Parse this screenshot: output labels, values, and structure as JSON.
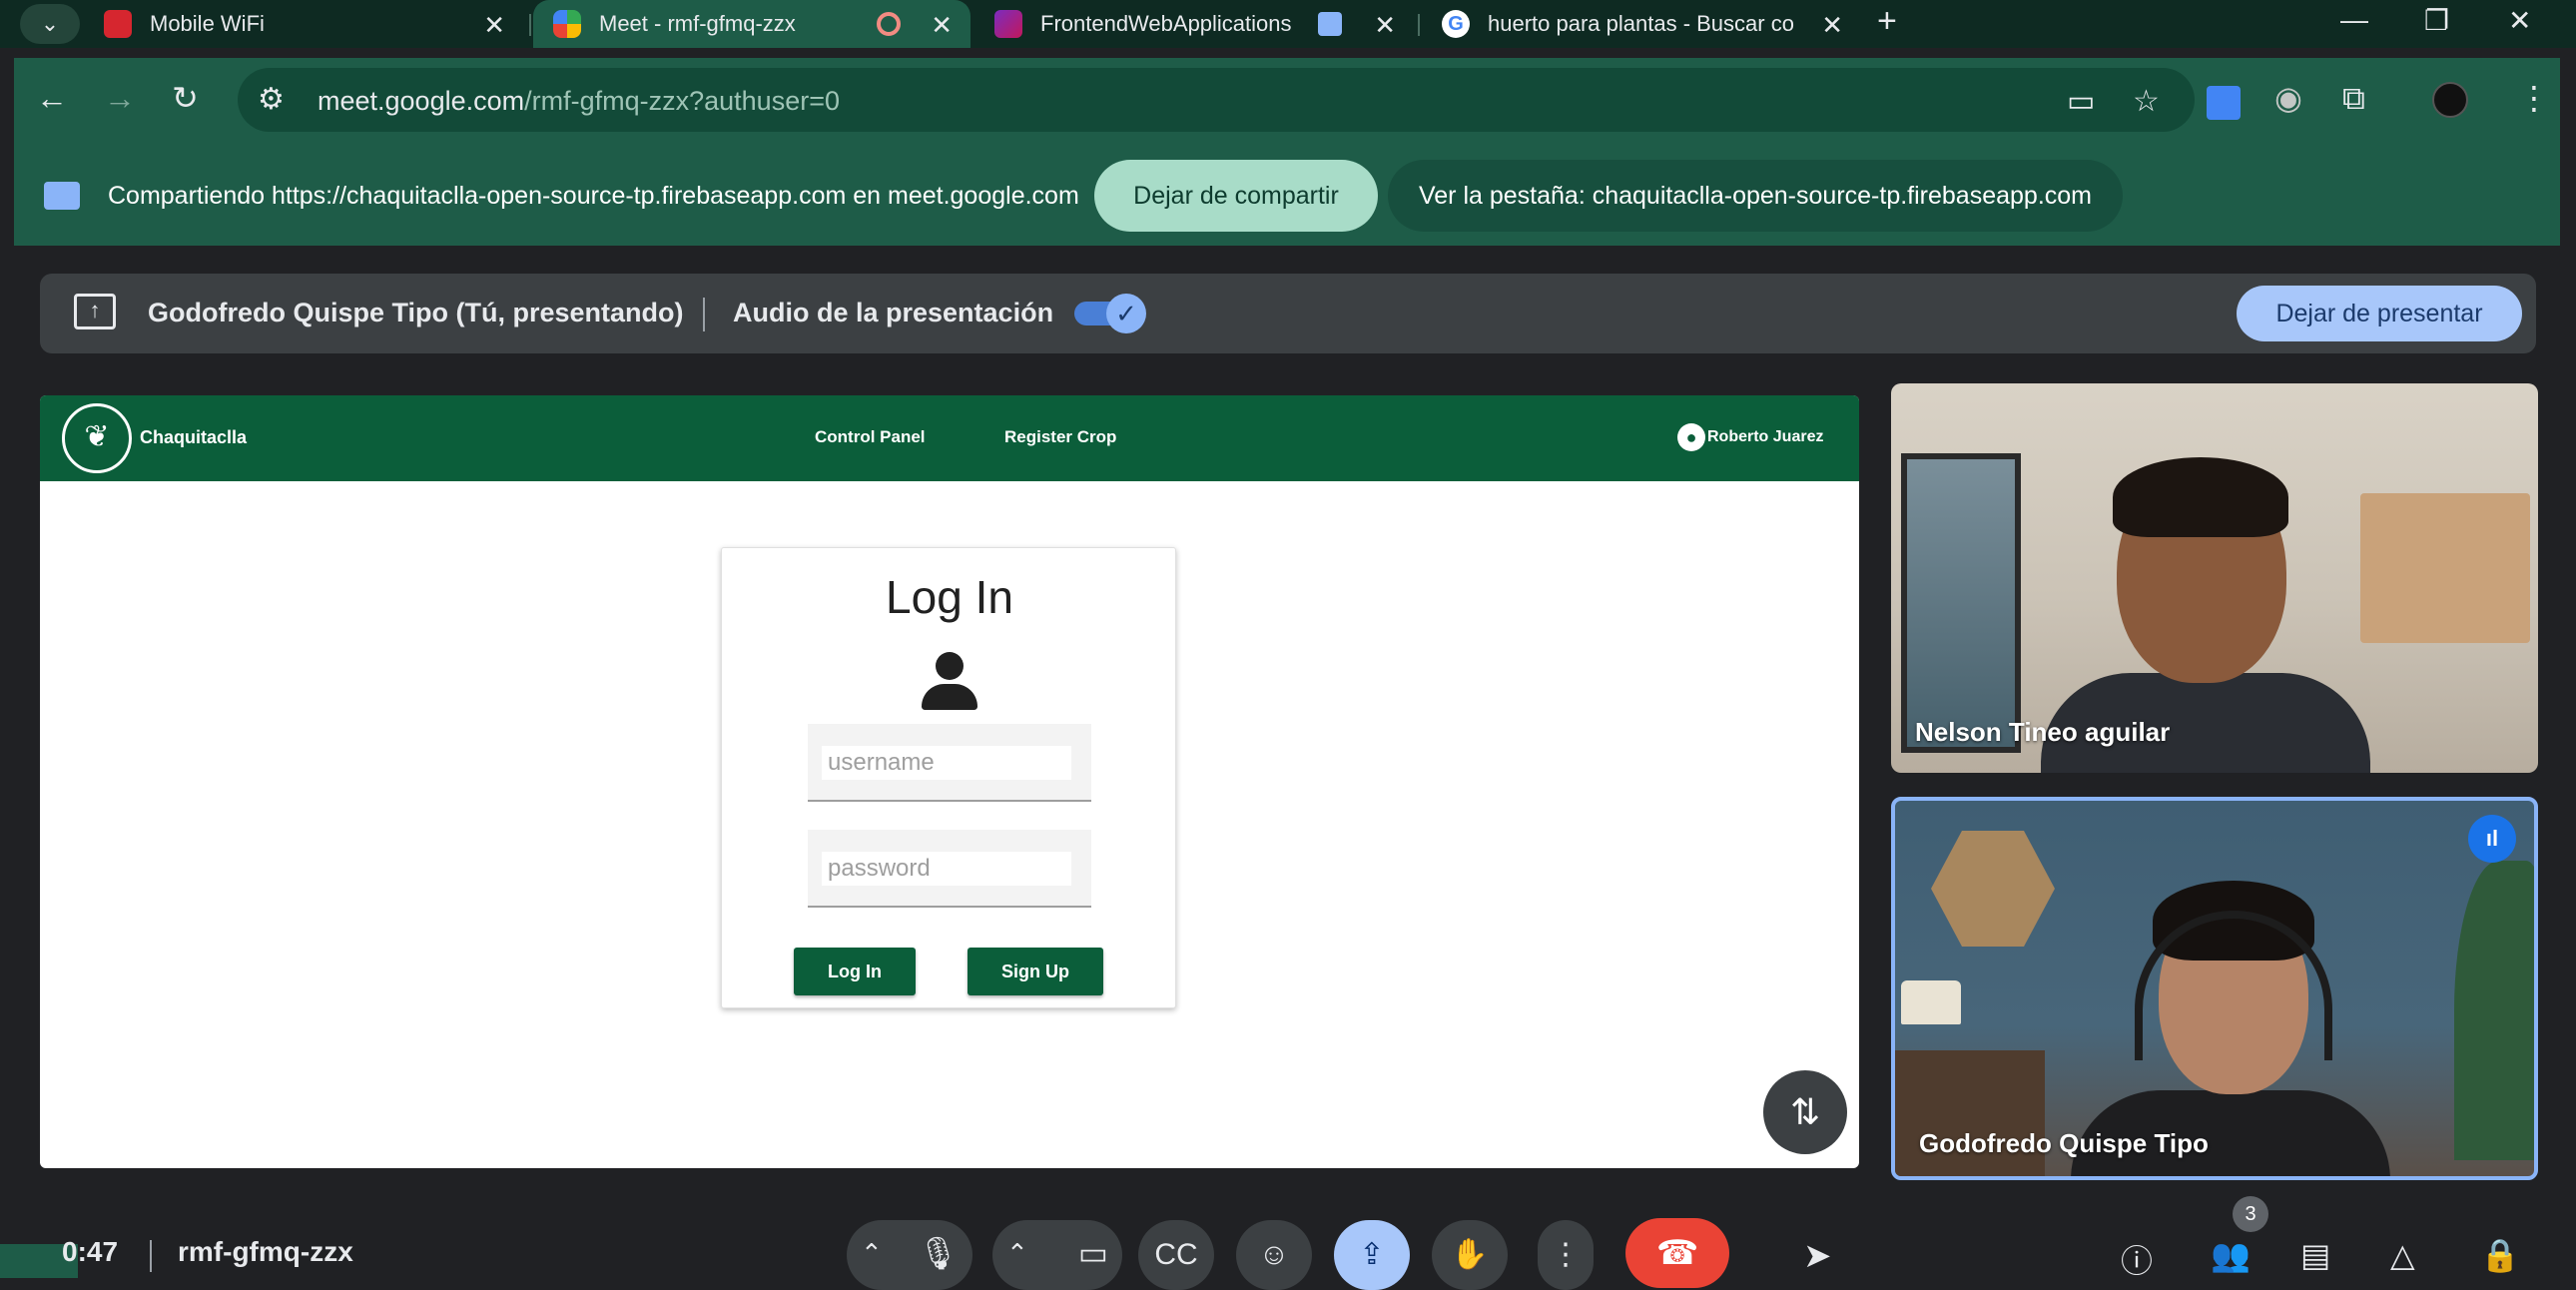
{
  "colors": {
    "chrome_frame": "#0e2a22",
    "chrome_toolbar": "#1e5c48",
    "meet_bg": "#202124",
    "app_green": "#0b5e3a",
    "end_call_red": "#ea4335",
    "meet_accent": "#8ab4f8"
  },
  "tabs": [
    {
      "title": "Mobile WiFi",
      "favicon": "huawei-icon",
      "active": false
    },
    {
      "title": "Meet - rmf-gfmq-zzx",
      "favicon": "meet-icon",
      "active": true
    },
    {
      "title": "FrontendWebApplications",
      "favicon": "course-icon",
      "active": false
    },
    {
      "title": "huerto para plantas - Buscar co",
      "favicon": "google-icon",
      "active": false
    }
  ],
  "omnibox": {
    "host": "meet.google.com",
    "path": "/rmf-gfmq-zzx?authuser=0"
  },
  "infobar": {
    "sharing_text": "Compartiendo https://chaquitaclla-open-source-tp.firebaseapp.com en meet.google.com",
    "stop_sharing": "Dejar de compartir",
    "view_tab": "Ver la pestaña: chaquitaclla-open-source-tp.firebaseapp.com"
  },
  "presenter_bar": {
    "presenter": "Godofredo Quispe Tipo (Tú, presentando)",
    "audio_label": "Audio de la presentación",
    "audio_on": true,
    "stop_presenting": "Dejar de presentar"
  },
  "app": {
    "brand": "Chaquitaclla",
    "nav": [
      "Control Panel",
      "Register Crop"
    ],
    "user": "Roberto Juarez",
    "login": {
      "title": "Log In",
      "username_placeholder": "username",
      "password_placeholder": "password",
      "login_button": "Log In",
      "signup_button": "Sign Up"
    }
  },
  "participants": [
    {
      "name": "Nelson Tineo aguilar"
    },
    {
      "name": "Godofredo Quispe Tipo",
      "speaking": true
    }
  ],
  "meeting": {
    "time": "0:47",
    "code": "rmf-gfmq-zzx",
    "people_count": "3"
  }
}
